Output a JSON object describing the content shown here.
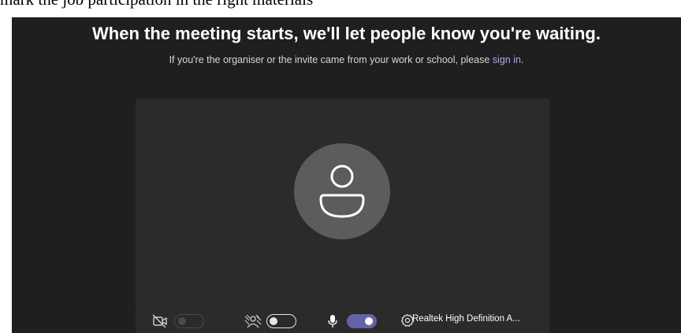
{
  "top_cut_text": "mark the job participation in the right materials",
  "prejoin": {
    "heading": "When the meeting starts, we'll let people know you're waiting.",
    "subtext_prefix": "If you're the organiser or the invite came from your work or school, please ",
    "signin_link": "sign in",
    "subtext_suffix": "."
  },
  "controls": {
    "camera": {
      "icon": "camera-off-icon",
      "state": "disabled"
    },
    "background_effects": {
      "icon": "background-blur-icon",
      "state": "off"
    },
    "microphone": {
      "icon": "microphone-icon",
      "state": "on"
    },
    "device_settings": {
      "icon": "gear-icon",
      "label": "Realtek High Definition A..."
    }
  },
  "colors": {
    "background": "#1f1f1f",
    "panel": "#2b2b2b",
    "avatar": "#5c5c5c",
    "accent": "#6264a7",
    "link": "#a7a9f5"
  }
}
